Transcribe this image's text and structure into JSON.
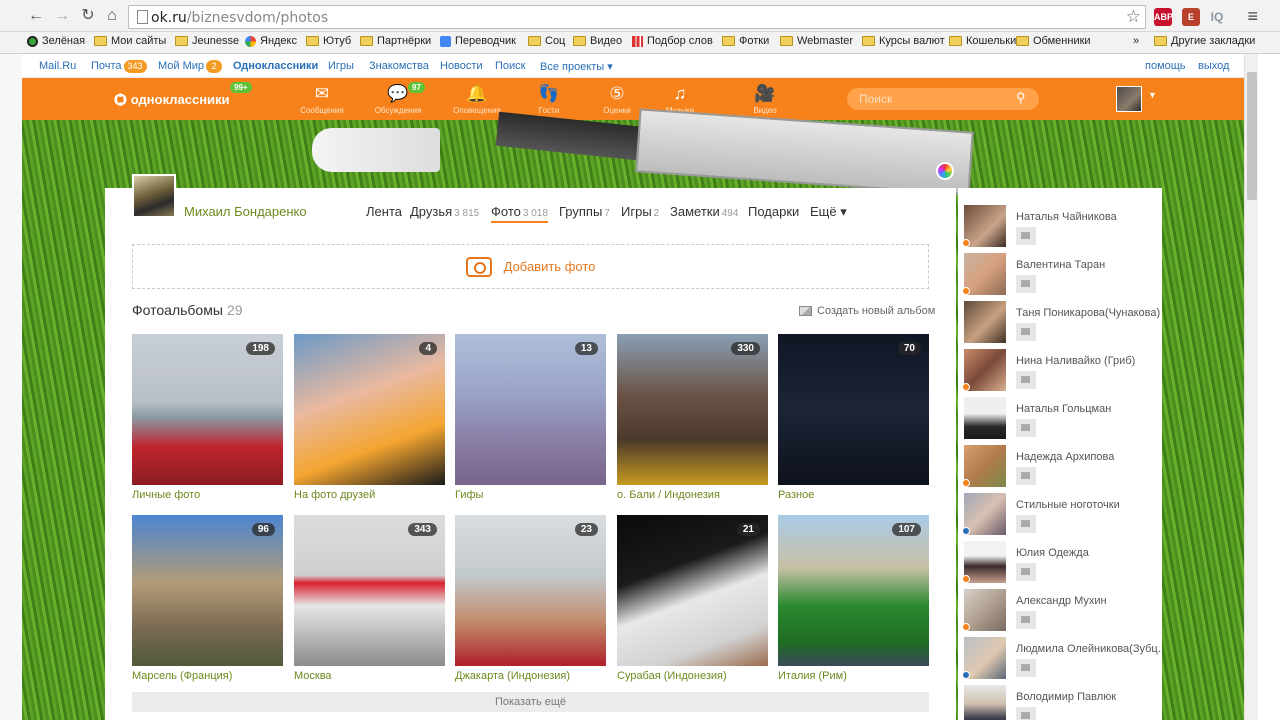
{
  "browser": {
    "url_host": "ok.ru",
    "url_path": "/biznesvdom/photos",
    "extensions": [
      {
        "name": "adblock-icon",
        "label": "ABP",
        "color": "#c8102e"
      },
      {
        "name": "evernote-icon",
        "label": "E",
        "color": "#b8412b"
      },
      {
        "name": "iq-icon",
        "label": "IQ",
        "color": "#9aa7b3"
      }
    ],
    "bookmarks": [
      {
        "label": "Зелёная",
        "icon": "green-circle-icon"
      },
      {
        "label": "Мои сайты",
        "icon": "folder-icon"
      },
      {
        "label": "Jeunesse",
        "icon": "folder-icon"
      },
      {
        "label": "Яндекс",
        "icon": "google-icon"
      },
      {
        "label": "Ютуб",
        "icon": "folder-icon"
      },
      {
        "label": "Партнёрки",
        "icon": "folder-icon"
      },
      {
        "label": "Переводчик",
        "icon": "translate-icon"
      },
      {
        "label": "Соц",
        "icon": "folder-icon"
      },
      {
        "label": "Видео",
        "icon": "folder-icon"
      },
      {
        "label": "Подбор слов",
        "icon": "chart-icon"
      },
      {
        "label": "Фотки",
        "icon": "folder-icon"
      },
      {
        "label": "Webmaster",
        "icon": "folder-icon"
      },
      {
        "label": "Курсы валют",
        "icon": "folder-icon"
      },
      {
        "label": "Кошельки",
        "icon": "folder-icon"
      },
      {
        "label": "Обменники",
        "icon": "folder-icon"
      }
    ],
    "bookmarks_more": "»",
    "other_bookmarks": "Другие закладки"
  },
  "mailru": {
    "mail_ru": "Mail.Ru",
    "pochta": "Почта",
    "pochta_count": "343",
    "moi_mir": "Мой Мир",
    "moi_mir_count": "2",
    "odnoklassniki": "Одноклассники",
    "igry": "Игры",
    "znakomstva": "Знакомства",
    "novosti": "Новости",
    "poisk": "Поиск",
    "vse_proekty": "Все проекты ▾",
    "pomosch": "помощь",
    "vyhod": "выход"
  },
  "ok": {
    "logo": "одноклассники",
    "logo_badge": "99+",
    "tools": [
      {
        "label": "Сообщения",
        "icon": "envelope-icon",
        "glyph": "✉",
        "badge": ""
      },
      {
        "label": "Обсуждения",
        "icon": "discussions-icon",
        "glyph": "💬",
        "badge": "97"
      },
      {
        "label": "Оповещения",
        "icon": "bell-icon",
        "glyph": "🔔",
        "badge": ""
      },
      {
        "label": "Гости",
        "icon": "footprints-icon",
        "glyph": "👣",
        "badge": ""
      },
      {
        "label": "Оценки",
        "icon": "ratings-icon",
        "glyph": "⑤",
        "badge": ""
      },
      {
        "label": "Музыка",
        "icon": "music-icon",
        "glyph": "♫",
        "badge": ""
      },
      {
        "label": "Видео",
        "icon": "video-icon",
        "glyph": "🎥",
        "badge": ""
      }
    ],
    "search_placeholder": "Поиск"
  },
  "profile": {
    "name": "Михаил Бондаренко",
    "tabs": [
      {
        "label": "Лента",
        "count": "",
        "active": false
      },
      {
        "label": "Друзья",
        "count": "3 815",
        "active": false
      },
      {
        "label": "Фото",
        "count": "3 018",
        "active": true
      },
      {
        "label": "Группы",
        "count": "7",
        "active": false
      },
      {
        "label": "Игры",
        "count": "2",
        "active": false
      },
      {
        "label": "Заметки",
        "count": "494",
        "active": false
      },
      {
        "label": "Подарки",
        "count": "",
        "active": false
      },
      {
        "label": "Ещё ▾",
        "count": "",
        "active": false
      }
    ]
  },
  "photos": {
    "add_photo": "Добавить фото",
    "albums_title": "Фотоальбомы",
    "albums_count": "29",
    "create_album": "Создать новый альбом",
    "albums": [
      {
        "title": "Личные фото",
        "count": "198",
        "bg": "linear-gradient(180deg,#c9cfd6 0%,#b8bfc4 45%,#8a9aa6 55%,#c0242c 75%,#8b1d22 100%)"
      },
      {
        "title": "На фото друзей",
        "count": "4",
        "bg": "linear-gradient(160deg,#6b9ac7 0%,#e9b9a0 40%,#f4a530 70%,#1a1a1a 100%)"
      },
      {
        "title": "Гифы",
        "count": "13",
        "bg": "linear-gradient(180deg,#aebfd8 0%,#9aa3c8 40%,#8b7fa6 70%,#77648b 100%)"
      },
      {
        "title": "о. Бали / Индонезия",
        "count": "330",
        "bg": "linear-gradient(180deg,#8aa0b5 0%,#6b5346 40%,#4b3a2c 70%,#c79a1f 100%)"
      },
      {
        "title": "Разное",
        "count": "70",
        "bg": "linear-gradient(180deg,#101624 0%,#1c2536 50%,#0d111c 100%)"
      },
      {
        "title": "Марсель (Франция)",
        "count": "96",
        "bg": "linear-gradient(180deg,#4c86d1 0%,#b39b77 45%,#7b6a52 75%,#4f5a3a 100%)"
      },
      {
        "title": "Москва",
        "count": "343",
        "bg": "linear-gradient(180deg,#dcdcdc 0%,#cfcfcf 40%,#d8202e 45%,#e7e7e7 60%,#8b8b8b 100%)"
      },
      {
        "title": "Джакарта (Индонезия)",
        "count": "23",
        "bg": "linear-gradient(180deg,#d9dde0 0%,#c2c9cd 40%,#c28d6e 70%,#b0202a 100%)"
      },
      {
        "title": "Сурабая (Индонезия)",
        "count": "21",
        "bg": "linear-gradient(160deg,#0a0a0a 0%,#1a1a1a 35%,#e8e8e8 55%,#d2d2d2 80%,#9b6d4e 100%)"
      },
      {
        "title": "Италия (Рим)",
        "count": "107",
        "bg": "linear-gradient(180deg,#a9cbe6 0%,#c8c0a6 35%,#2a8a2e 60%,#1f6b24 85%,#3b4a5a 100%)"
      }
    ],
    "show_more": "Показать ещё"
  },
  "friends": [
    {
      "name": "Наталья Чайникова",
      "online": "#f7821b",
      "bg": "linear-gradient(135deg,#6d4a3a,#c9a48a 60%,#3a2a22)"
    },
    {
      "name": "Валентина Таран",
      "online": "#f7821b",
      "bg": "linear-gradient(135deg,#c8b4a0,#d9a080 50%,#8a6a52)"
    },
    {
      "name": "Таня Поникарова(Чунакова)",
      "online": "",
      "bg": "linear-gradient(135deg,#5a4a3a,#c8a080 55%,#3d3026)"
    },
    {
      "name": "Нина Наливайко (Гриб)",
      "online": "#f7821b",
      "bg": "linear-gradient(135deg,#c98a6a,#7a4a3a 50%,#d9b090)"
    },
    {
      "name": "Наталья Гольцман",
      "online": "",
      "bg": "linear-gradient(180deg,#efefef 0%,#efefef 40%,#2a2a2a 70%,#1a1a1a)"
    },
    {
      "name": "Надежда Архипова",
      "online": "#f7821b",
      "bg": "linear-gradient(135deg,#d9a070,#b07a4a 50%,#7a8a4a)"
    },
    {
      "name": "Стильные ноготочки",
      "online": "#2a6fb6",
      "bg": "linear-gradient(135deg,#a0a8b8,#d8c0b0 50%,#6a5a6a)"
    },
    {
      "name": "Юлия Одежда",
      "online": "#f7821b",
      "bg": "linear-gradient(180deg,#f2f2f2 0%,#f2f2f2 35%,#3a2a2a 60%,#c8a090)"
    },
    {
      "name": "Александр Мухин",
      "online": "#f7821b",
      "bg": "linear-gradient(135deg,#d8d0c8,#b0a090 50%,#7a6a60)"
    },
    {
      "name": "Людмила Олейникова(Зубц...",
      "online": "#2a6fb6",
      "bg": "linear-gradient(135deg,#b8c0c8,#e0c8b0 55%,#5a6a7a)"
    },
    {
      "name": "Володимир Павлюк",
      "online": "",
      "bg": "linear-gradient(180deg,#e8e8e8 0%,#d0c0b0 45%,#3a3a4a 80%)"
    }
  ]
}
